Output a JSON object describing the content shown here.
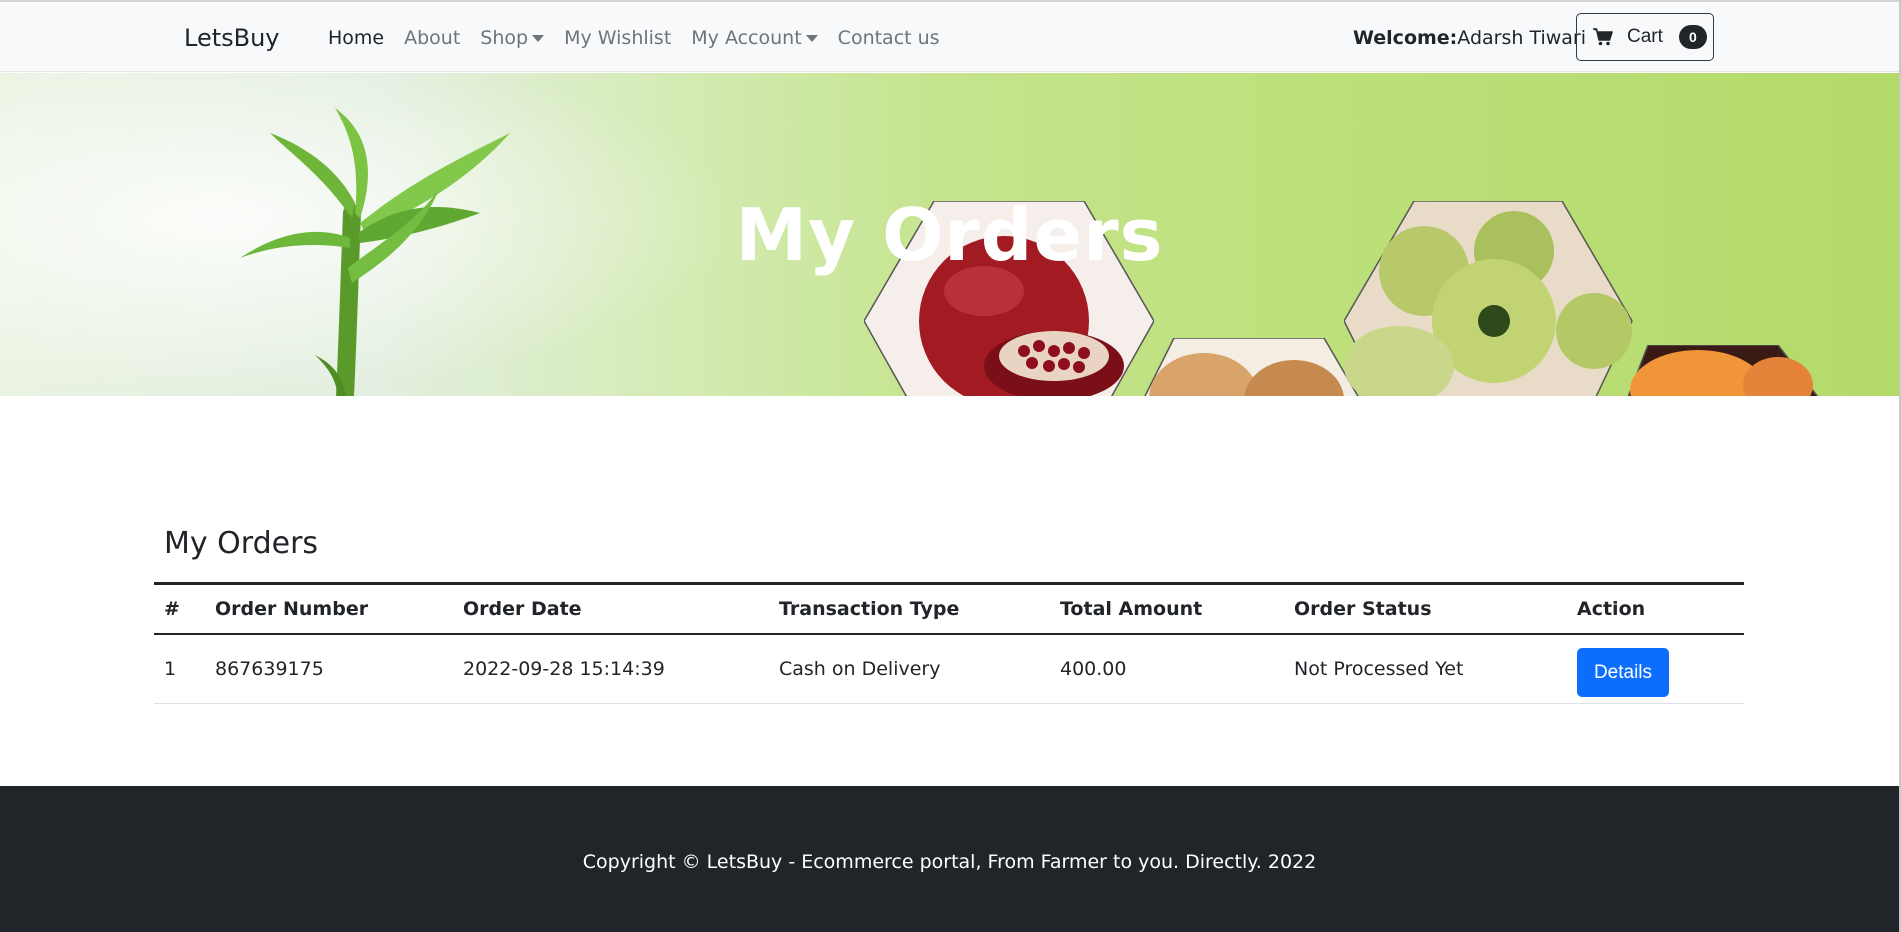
{
  "navbar": {
    "brand": "LetsBuy",
    "links": [
      {
        "label": "Home",
        "active": true,
        "dropdown": false
      },
      {
        "label": "About",
        "active": false,
        "dropdown": false
      },
      {
        "label": "Shop",
        "active": false,
        "dropdown": true
      },
      {
        "label": "My Wishlist",
        "active": false,
        "dropdown": false
      },
      {
        "label": "My Account",
        "active": false,
        "dropdown": true
      },
      {
        "label": "Contact us",
        "active": false,
        "dropdown": false
      }
    ],
    "welcome_label": "Welcome:",
    "user_name": "Adarsh Tiwari",
    "cart_label": "Cart",
    "cart_count": "0",
    "cart_icon": "cart-icon"
  },
  "hero": {
    "title": "My Orders"
  },
  "orders": {
    "heading": "My Orders",
    "columns": [
      "#",
      "Order Number",
      "Order Date",
      "Transaction Type",
      "Total Amount",
      "Order Status",
      "Action"
    ],
    "rows": [
      {
        "index": "1",
        "order_number": "867639175",
        "order_date": "2022-09-28 15:14:39",
        "transaction_type": "Cash on Delivery",
        "total_amount": "400.00",
        "order_status": "Not Processed Yet",
        "action_label": "Details"
      }
    ]
  },
  "footer": {
    "text": "Copyright © LetsBuy - Ecommerce portal, From Farmer to you. Directly. 2022"
  },
  "colors": {
    "primary": "#0d6efd",
    "dark": "#212529",
    "navbar_bg": "#f8f9fa"
  }
}
